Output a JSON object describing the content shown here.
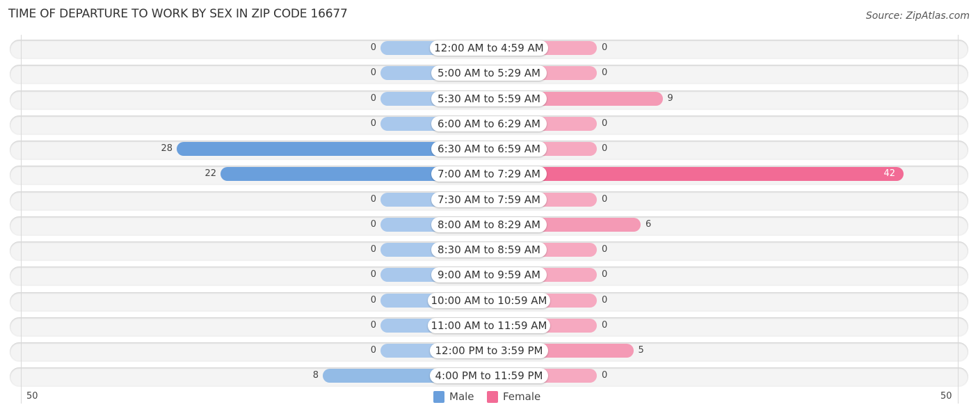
{
  "title": "TIME OF DEPARTURE TO WORK BY SEX IN ZIP CODE 16677",
  "source": "Source: ZipAtlas.com",
  "colors": {
    "male": "#6a9fdc",
    "male_light": "#a9c8ec",
    "female": "#f26b95",
    "female_light": "#f6a9c0"
  },
  "chart_data": {
    "type": "bar",
    "orientation": "horizontal-diverging",
    "title": "TIME OF DEPARTURE TO WORK BY SEX IN ZIP CODE 16677",
    "categories": [
      "12:00 AM to 4:59 AM",
      "5:00 AM to 5:29 AM",
      "5:30 AM to 5:59 AM",
      "6:00 AM to 6:29 AM",
      "6:30 AM to 6:59 AM",
      "7:00 AM to 7:29 AM",
      "7:30 AM to 7:59 AM",
      "8:00 AM to 8:29 AM",
      "8:30 AM to 8:59 AM",
      "9:00 AM to 9:59 AM",
      "10:00 AM to 10:59 AM",
      "11:00 AM to 11:59 AM",
      "12:00 PM to 3:59 PM",
      "4:00 PM to 11:59 PM"
    ],
    "series": [
      {
        "name": "Male",
        "values": [
          0,
          0,
          0,
          0,
          28,
          22,
          0,
          0,
          0,
          0,
          0,
          0,
          0,
          8
        ]
      },
      {
        "name": "Female",
        "values": [
          0,
          0,
          9,
          0,
          0,
          42,
          0,
          6,
          0,
          0,
          0,
          0,
          5,
          0
        ]
      }
    ],
    "axis": {
      "left_label": "50",
      "right_label": "50",
      "range": [
        -50,
        50
      ]
    },
    "legend": {
      "position": "bottom-center",
      "entries": [
        "Male",
        "Female"
      ]
    },
    "grid": false
  }
}
